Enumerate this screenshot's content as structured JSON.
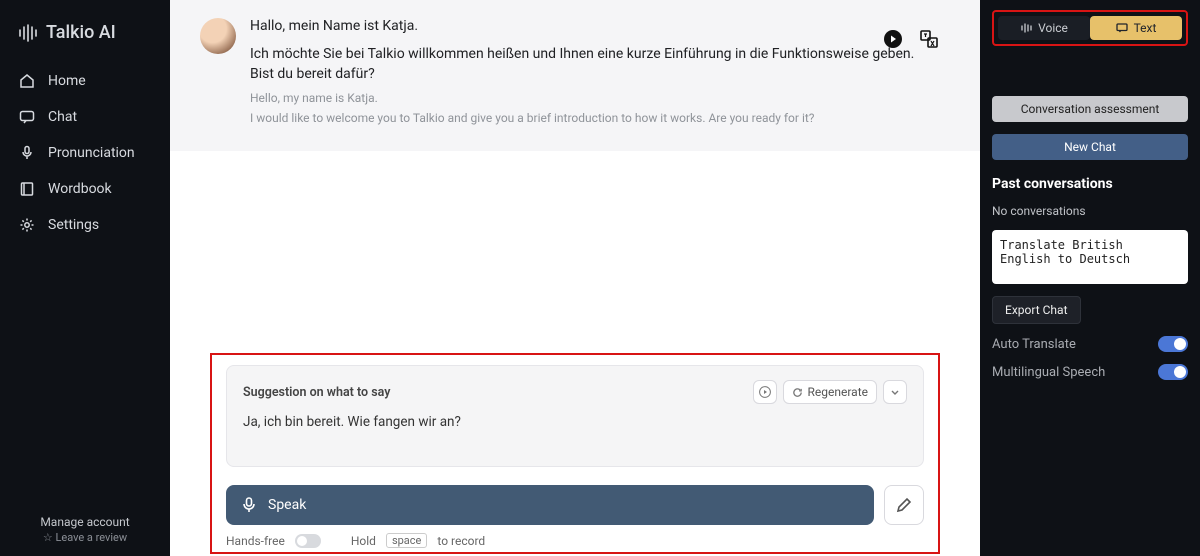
{
  "brand": "Talkio AI",
  "nav": {
    "home": "Home",
    "chat": "Chat",
    "pronunciation": "Pronunciation",
    "wordbook": "Wordbook",
    "settings": "Settings"
  },
  "sidebar_footer": {
    "manage": "Manage account",
    "review": "☆ Leave a review"
  },
  "message": {
    "greeting": "Hallo, mein Name ist Katja.",
    "body": "Ich möchte Sie bei Talkio willkommen heißen und Ihnen eine kurze Einführung in die Funktionsweise geben. Bist du bereit dafür?",
    "trans1": "Hello, my name is Katja.",
    "trans2": "I would like to welcome you to Talkio and give you a brief introduction to how it works. Are you ready for it?"
  },
  "suggestion": {
    "title": "Suggestion on what to say",
    "regenerate": "Regenerate",
    "text": "Ja, ich bin bereit. Wie fangen wir an?"
  },
  "speak": {
    "label": "Speak",
    "hint_handsfree": "Hands-free",
    "hint_hold": "Hold",
    "hint_key": "space",
    "hint_tail": "to record"
  },
  "right": {
    "voice": "Voice",
    "text": "Text",
    "assessment": "Conversation assessment",
    "newchat": "New Chat",
    "past_heading": "Past conversations",
    "past_empty": "No conversations",
    "textarea_value": "Translate British English to Deutsch",
    "export": "Export Chat",
    "auto_translate": "Auto Translate",
    "multilingual": "Multilingual Speech"
  }
}
